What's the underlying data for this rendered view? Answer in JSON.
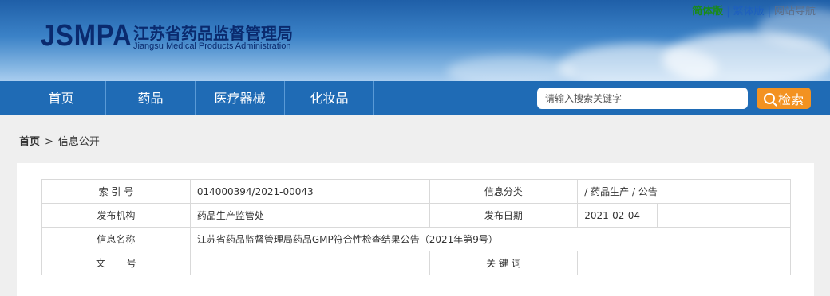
{
  "header": {
    "logo_en": "JSMPA",
    "logo_cn": "江苏省药品监督管理局",
    "logo_sub": "Jiangsu Medical Products Administration",
    "lang_links": {
      "simplified": "简体版",
      "traditional": "繁体版",
      "site_nav": "网站导航",
      "separator": "|"
    }
  },
  "nav": {
    "items": [
      "首页",
      "药品",
      "医疗器械",
      "化妆品"
    ],
    "search_placeholder": "请输入搜索关键字",
    "search_button": "检索"
  },
  "breadcrumb": {
    "home": "首页",
    "arrow": ">",
    "current": "信息公开"
  },
  "info_table": {
    "index_label": "索 引 号",
    "index_value": "014000394/2021-00043",
    "category_label": "信息分类",
    "category_value": "/  药品生产  /  公告",
    "publisher_label": "发布机构",
    "publisher_value": "药品生产监管处",
    "date_label": "发布日期",
    "date_value": "2021-02-04",
    "name_label": "信息名称",
    "name_value": "江苏省药品监督管理局药品GMP符合性检查结果公告（2021年第9号）",
    "doc_no_label": "文       号",
    "doc_no_value": "",
    "keywords_label": "关 键 词",
    "keywords_value": ""
  }
}
